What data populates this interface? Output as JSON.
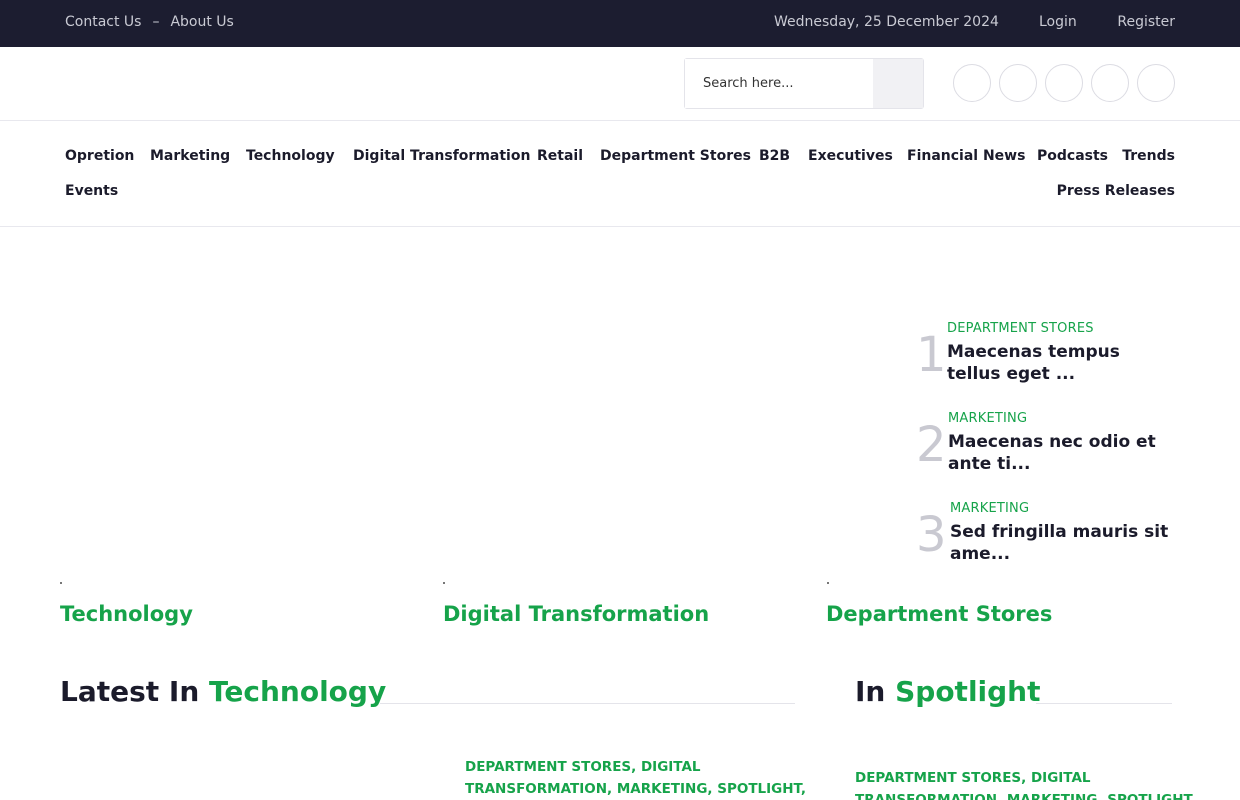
{
  "topbar": {
    "contact": "Contact Us",
    "separator": "–",
    "about": "About Us",
    "date": "Wednesday, 25 December 2024",
    "login": "Login",
    "register": "Register"
  },
  "search": {
    "placeholder": "Search here..."
  },
  "socials": [
    "facebook-icon",
    "twitter-icon",
    "instagram-icon",
    "linkedin-icon",
    "youtube-icon"
  ],
  "nav": {
    "items": [
      "Opretion",
      "Marketing",
      "Technology",
      "Digital Transformation",
      "Retail",
      "Department Stores",
      "B2B",
      "Executives",
      "Financial News",
      "Podcasts",
      "Trends",
      "Events",
      "Press Releases"
    ]
  },
  "trending": [
    {
      "num": "1",
      "category": "DEPARTMENT STORES",
      "title": "Maecenas tempus tellus eget ..."
    },
    {
      "num": "2",
      "category": "MARKETING",
      "title": "Maecenas nec odio et ante ti..."
    },
    {
      "num": "3",
      "category": "MARKETING",
      "title": "Sed fringilla mauris sit ame..."
    }
  ],
  "cards": [
    "Technology",
    "Digital Transformation",
    "Department Stores"
  ],
  "latest": {
    "prefix": "Latest In",
    "accent": "Technology"
  },
  "spotlight": {
    "prefix": "In",
    "accent": "Spotlight"
  },
  "latest_meta": {
    "line1": "DEPARTMENT STORES, DIGITAL",
    "line2": "TRANSFORMATION, MARKETING, SPOTLIGHT,"
  },
  "spotlight_meta": {
    "line1": "DEPARTMENT STORES, DIGITAL",
    "line2": "TRANSFORMATION, MARKETING, SPOTLIGHT"
  },
  "colors": {
    "accent": "#16a34a",
    "topbar": "#1c1d30",
    "text": "#1b1b2b"
  }
}
